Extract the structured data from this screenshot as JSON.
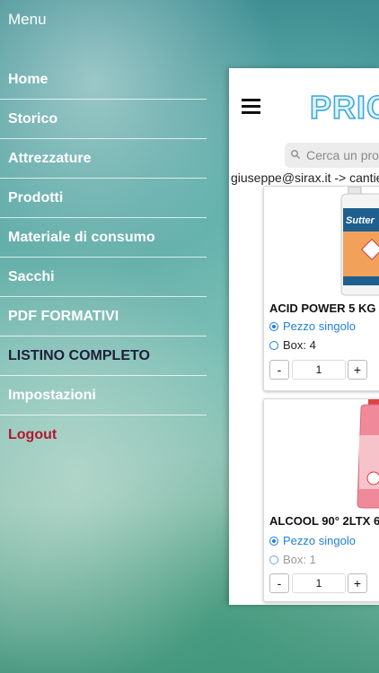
{
  "menu": {
    "title": "Menu",
    "items": [
      {
        "label": "Home"
      },
      {
        "label": "Storico"
      },
      {
        "label": "Attrezzature"
      },
      {
        "label": "Prodotti"
      },
      {
        "label": "Materiale di consumo"
      },
      {
        "label": "Sacchi"
      },
      {
        "label": "PDF FORMATIVI"
      },
      {
        "label": "LISTINO COMPLETO"
      },
      {
        "label": "Impostazioni"
      },
      {
        "label": "Logout"
      }
    ]
  },
  "header": {
    "logo_text": "PRIC"
  },
  "search": {
    "placeholder": "Cerca un pro"
  },
  "user_line": "giuseppe@sirax.it -> cantie",
  "products": [
    {
      "name": "ACID POWER 5 KG",
      "brand_text": "Sutter",
      "option_single": "Pezzo singolo",
      "option_box": "Box: 4",
      "quantity": "1",
      "minus": "-",
      "plus": "+"
    },
    {
      "name": "ALCOOL 90° 2LTX 6",
      "option_single": "Pezzo singolo",
      "option_box": "Box: 1",
      "quantity": "1",
      "minus": "-",
      "plus": "+"
    }
  ],
  "colors": {
    "accent": "#1e7fd6",
    "logout": "#b3172f",
    "listino": "#1f1f3a"
  }
}
